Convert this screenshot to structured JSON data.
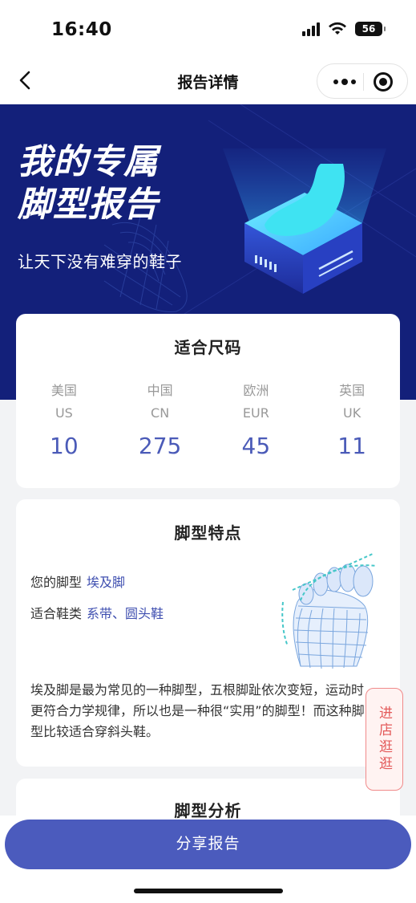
{
  "status": {
    "time": "16:40",
    "battery": "56"
  },
  "nav": {
    "title": "报告详情"
  },
  "banner": {
    "title_line1": "我的专属",
    "title_line2": "脚型报告",
    "subtitle": "让天下没有难穿的鞋子"
  },
  "size_card": {
    "title": "适合尺码",
    "sizes": [
      {
        "region": "美国",
        "code": "US",
        "value": "10"
      },
      {
        "region": "中国",
        "code": "CN",
        "value": "275"
      },
      {
        "region": "欧洲",
        "code": "EUR",
        "value": "45"
      },
      {
        "region": "英国",
        "code": "UK",
        "value": "11"
      }
    ]
  },
  "feature_card": {
    "title": "脚型特点",
    "foot_type_label": "您的脚型",
    "foot_type_value": "埃及脚",
    "shoe_type_label": "适合鞋类",
    "shoe_type_value": "系带、圆头鞋",
    "description": "埃及脚是最为常见的一种脚型，五根脚趾依次变短，运动时更符合力学规律，所以也是一种很“实用”的脚型！而这种脚型比较适合穿斜头鞋。"
  },
  "analysis_card": {
    "title": "脚型分析"
  },
  "float_button": {
    "label": "进店逛逛"
  },
  "share_button": {
    "label": "分享报告"
  },
  "colors": {
    "accent": "#4b5bbd",
    "banner_bg": "#13207a",
    "highlight": "#fde4c8",
    "shop_red": "#e35a5a"
  }
}
